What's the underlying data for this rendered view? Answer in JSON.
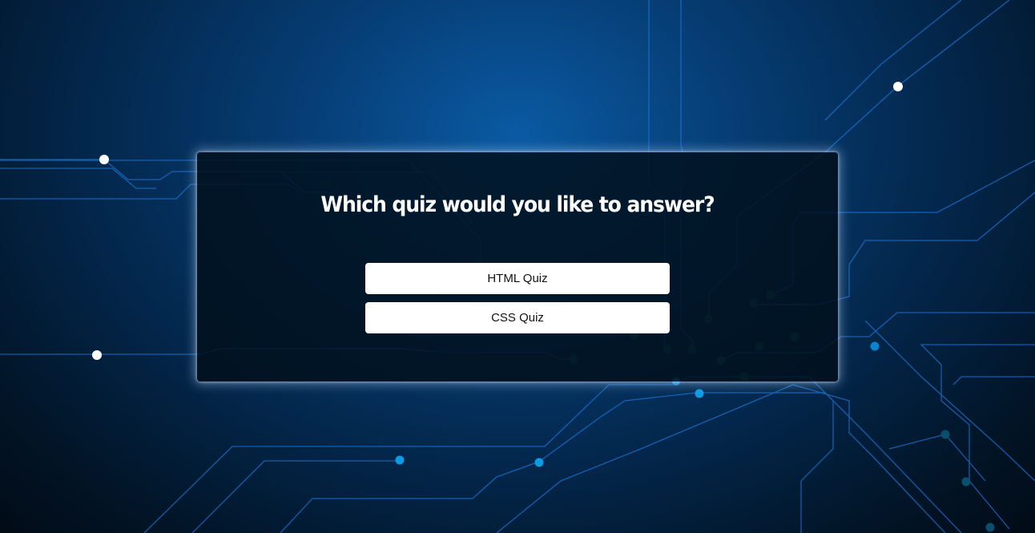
{
  "colors": {
    "background_center": "#0a5aa3",
    "background_edge": "#010b16",
    "circuit_line": "#1a74d6",
    "circuit_node_bright": "#0e9be6",
    "circuit_node_dim": "#0a4f6e",
    "circuit_node_white": "#ffffff",
    "card_background": "#010f1c",
    "button_background": "#ffffff",
    "button_text": "#111111",
    "title_text": "#ffffff"
  },
  "quiz": {
    "title": "Which quiz would you like to answer?",
    "options": [
      {
        "label": "HTML Quiz"
      },
      {
        "label": "CSS Quiz"
      }
    ]
  }
}
